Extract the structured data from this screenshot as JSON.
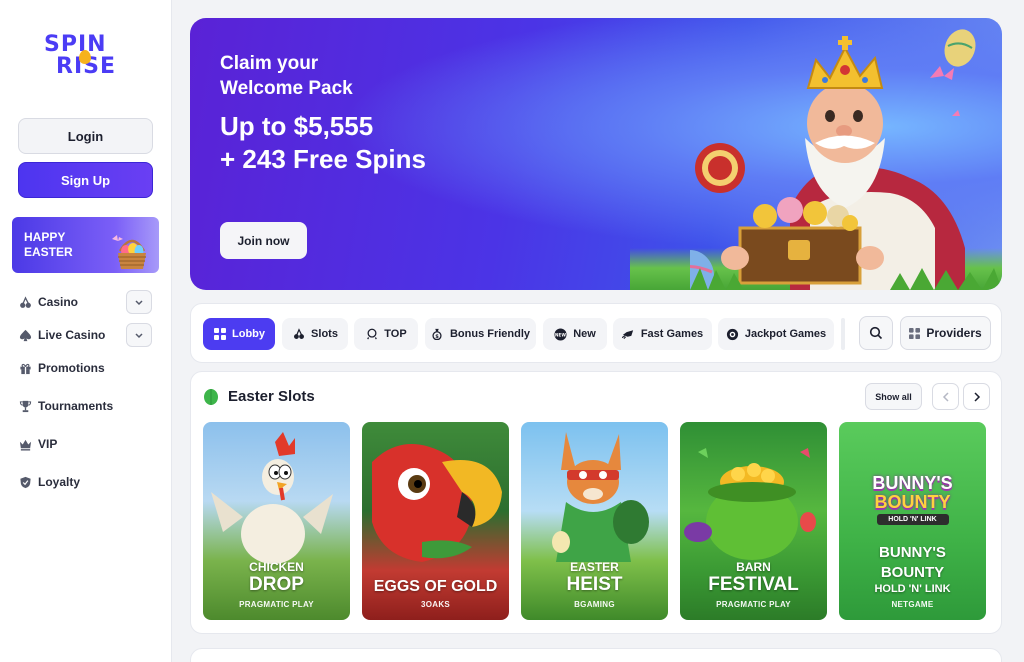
{
  "brand": {
    "logo_line1": "SPIN",
    "logo_line2": "RISE"
  },
  "auth": {
    "login_label": "Login",
    "signup_label": "Sign Up"
  },
  "promo_banner": {
    "line1": "HAPPY",
    "line2": "EASTER"
  },
  "sidebar": {
    "items": [
      {
        "label": "Casino",
        "icon": "cherries-icon",
        "expandable": true
      },
      {
        "label": "Live Casino",
        "icon": "spade-icon",
        "expandable": true
      },
      {
        "label": "Promotions",
        "icon": "gift-icon",
        "expandable": false
      },
      {
        "label": "Tournaments",
        "icon": "trophy-icon",
        "expandable": false
      },
      {
        "label": "VIP",
        "icon": "crown-icon",
        "expandable": false
      },
      {
        "label": "Loyalty",
        "icon": "shield-icon",
        "expandable": false
      }
    ]
  },
  "hero": {
    "claim_line1": "Claim your",
    "claim_line2": "Welcome Pack",
    "amount_line1": "Up to $5,555",
    "amount_line2": "+ 243 Free Spins",
    "cta_label": "Join now"
  },
  "categories": {
    "items": [
      {
        "label": "Lobby",
        "icon": "grid-icon",
        "active": true
      },
      {
        "label": "Slots",
        "icon": "cherries-icon",
        "active": false
      },
      {
        "label": "TOP",
        "icon": "crown-icon",
        "active": false
      },
      {
        "label": "Bonus Friendly",
        "icon": "moneybag-icon",
        "active": false
      },
      {
        "label": "New",
        "icon": "new-badge-icon",
        "active": false
      },
      {
        "label": "Fast Games",
        "icon": "rocket-icon",
        "active": false
      },
      {
        "label": "Jackpot Games",
        "icon": "jackpot-icon",
        "active": false
      }
    ],
    "providers_label": "Providers"
  },
  "easter_slots": {
    "title": "Easter Slots",
    "show_all_label": "Show all",
    "games": [
      {
        "title_top": "CHICKEN",
        "title_main": "DROP",
        "provider": "PRAGMATIC PLAY"
      },
      {
        "title_top": "",
        "title_main": "EGGS OF GOLD",
        "provider": "3OAKS"
      },
      {
        "title_top": "EASTER",
        "title_main": "HEIST",
        "provider": "BGAMING"
      },
      {
        "title_top": "BARN",
        "title_main": "FESTIVAL",
        "provider": "PRAGMATIC PLAY"
      },
      {
        "title_top": "BUNNY'S",
        "title_main": "BOUNTY",
        "subtitle": "HOLD 'N' LINK",
        "provider": "NETGAME"
      }
    ],
    "bunny_logo_line1": "BUNNY'S",
    "bunny_logo_line2": "BOUNTY",
    "bunny_logo_line3": "HOLD 'N' LINK"
  },
  "colors": {
    "accent": "#4c3cf1",
    "background": "#f2f3f6",
    "card_bg": "#ffffff"
  }
}
